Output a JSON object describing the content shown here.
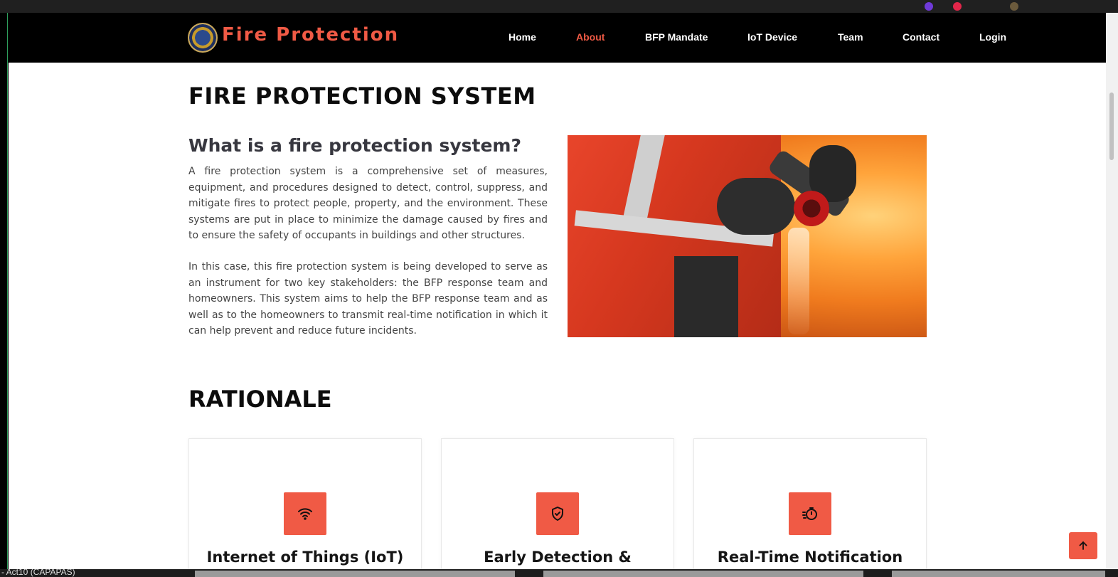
{
  "nav": {
    "brand": "Fire Protection",
    "links": [
      "Home",
      "About",
      "BFP Mandate",
      "IoT Device",
      "Team",
      "Contact",
      "Login"
    ],
    "active": "About"
  },
  "section": {
    "title": "FIRE PROTECTION SYSTEM",
    "subtitle": "What is a fire protection system?",
    "paragraph_1": "A fire protection system is a comprehensive set of measures, equipment, and procedures designed to detect, control, suppress, and mitigate fires to protect people, property, and the environment. These systems are put in place to minimize the damage caused by fires and to ensure the safety of occupants in buildings and other structures.",
    "paragraph_2": "In this case, this fire protection system is being developed to serve as an instrument for two key stakeholders: the BFP response team and homeowners. This system aims to help the BFP response team and as well as to the homeowners to transmit real-time notification in which it can help prevent and reduce future incidents."
  },
  "rationale": {
    "title": "RATIONALE",
    "cards": [
      {
        "title": "Internet of Things (IoT)",
        "icon": "wifi-icon"
      },
      {
        "title": "Early Detection &",
        "icon": "shield-check-icon"
      },
      {
        "title": "Real-Time Notification",
        "icon": "stopwatch-icon"
      }
    ]
  },
  "taskbar": {
    "label": "- Act10 (CAPAPAS)"
  },
  "colors": {
    "accent": "#f05a45",
    "navbar": "#000000"
  }
}
